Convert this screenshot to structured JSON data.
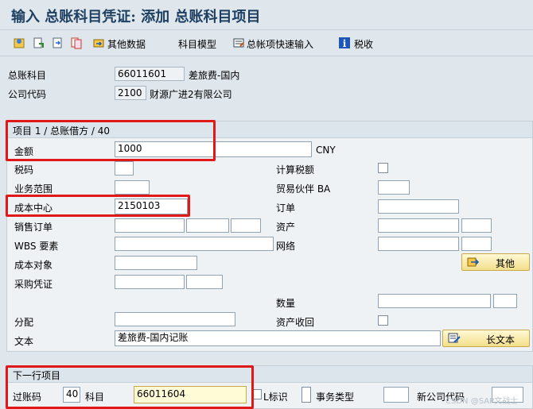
{
  "header": {
    "title": "输入 总账科目凭证: 添加 总账科目项目"
  },
  "toolbar": {
    "other_data": "其他数据",
    "account_model": "科目模型",
    "fast_entry": "总帐项快速输入",
    "tax": "税收"
  },
  "top": {
    "gl_account_label": "总账科目",
    "gl_account_value": "66011601",
    "gl_account_text": "差旅费-国内",
    "company_code_label": "公司代码",
    "company_code_value": "2100",
    "company_code_text": "财源广进2有限公司"
  },
  "item": {
    "header": "项目 1 / 总账借方 / 40",
    "amount_label": "金额",
    "amount_value": "1000",
    "currency": "CNY",
    "tax_code_label": "税码",
    "calc_tax_label": "计算税额",
    "business_area_label": "业务范围",
    "trading_partner_label": "贸易伙伴 BA",
    "cost_center_label": "成本中心",
    "cost_center_value": "2150103",
    "order_label": "订单",
    "sales_order_label": "销售订单",
    "asset_label": "资产",
    "wbs_label": "WBS 要素",
    "network_label": "网络",
    "cost_object_label": "成本对象",
    "more_button": "其他",
    "purchasing_doc_label": "采购凭证",
    "quantity_label": "数量",
    "assignment_label": "分配",
    "asset_retirement_label": "资产收回",
    "text_label": "文本",
    "text_value": "差旅费-国内记账",
    "long_text_button": "长文本"
  },
  "next": {
    "header": "下一行项目",
    "posting_key_label": "过账码",
    "posting_key_value": "40",
    "account_label": "科目",
    "account_value": "66011604",
    "sgl_label": "L标识",
    "transaction_type_label": "事务类型",
    "new_company_code_label": "新公司代码"
  },
  "watermark": "CSDN @SAP文战士",
  "colors": {
    "title": "#1d3f61",
    "highlight_box": "#e01818",
    "button": "#f3df8a"
  }
}
